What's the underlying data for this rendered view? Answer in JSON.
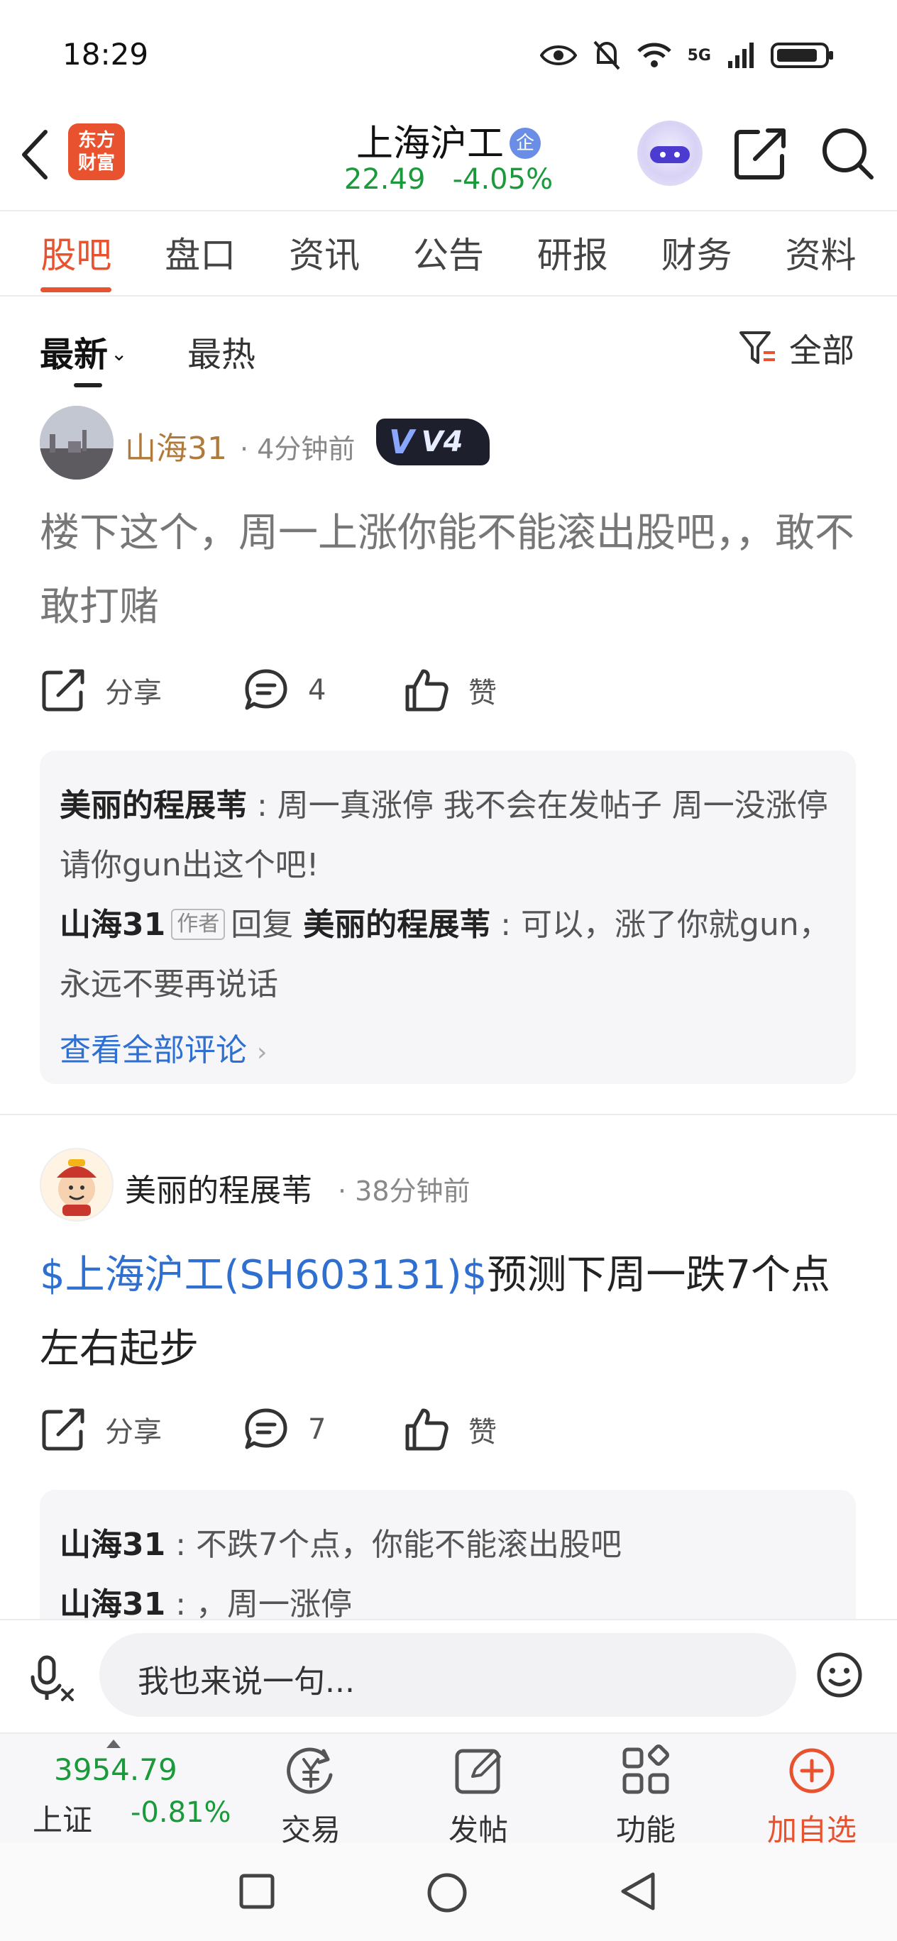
{
  "status": {
    "time": "18:29",
    "network": "5G"
  },
  "header": {
    "logo_text": "东方财富",
    "stock_name": "上海沪工",
    "verified_badge": "企",
    "price": "22.49",
    "change": "-4.05%"
  },
  "tabs": [
    "股吧",
    "盘口",
    "资讯",
    "公告",
    "研报",
    "财务",
    "资料"
  ],
  "active_tab": "股吧",
  "subtabs": {
    "latest": "最新",
    "hot": "最热",
    "filter": "全部"
  },
  "posts": [
    {
      "author": "山海31",
      "time": "· 4分钟前",
      "level": "V4",
      "body": "楼下这个，周一上涨你能不能滚出股吧，，敢不敢打赌",
      "share_label": "分享",
      "comment_count": "4",
      "like_label": "赞",
      "comments": [
        {
          "name": "美丽的程展苇",
          "sep": " : ",
          "text": "周一真涨停 我不会在发帖子 周一没涨停 请你gun出这个吧!"
        },
        {
          "name": "山海31",
          "tag": "作者",
          "reply_word": "回复",
          "reply_to": "美丽的程展苇",
          "sep": " : ",
          "text": "可以，涨了你就gun，永远不要再说话"
        }
      ],
      "view_all": "查看全部评论"
    },
    {
      "author": "美丽的程展苇",
      "time": "· 38分钟前",
      "body_ticker": "$上海沪工(SH603131)$",
      "body_text": "预测下周一跌7个点左右起步",
      "share_label": "分享",
      "comment_count": "7",
      "like_label": "赞",
      "comments": [
        {
          "name": "山海31",
          "sep": " : ",
          "text": "不跌7个点，你能不能滚出股吧"
        },
        {
          "name": "山海31",
          "sep": " : ",
          "text": "，周一涨停"
        }
      ]
    }
  ],
  "reply": {
    "placeholder": "我也来说一句..."
  },
  "bottom_nav": {
    "index_value": "3954.79",
    "index_name": "上证",
    "index_change": "-0.81%",
    "trade": "交易",
    "post": "发帖",
    "functions": "功能",
    "add_watch": "加自选"
  },
  "colors": {
    "accent": "#e8522f",
    "down_green": "#1a9a3a",
    "link_blue": "#2e6fd0"
  }
}
